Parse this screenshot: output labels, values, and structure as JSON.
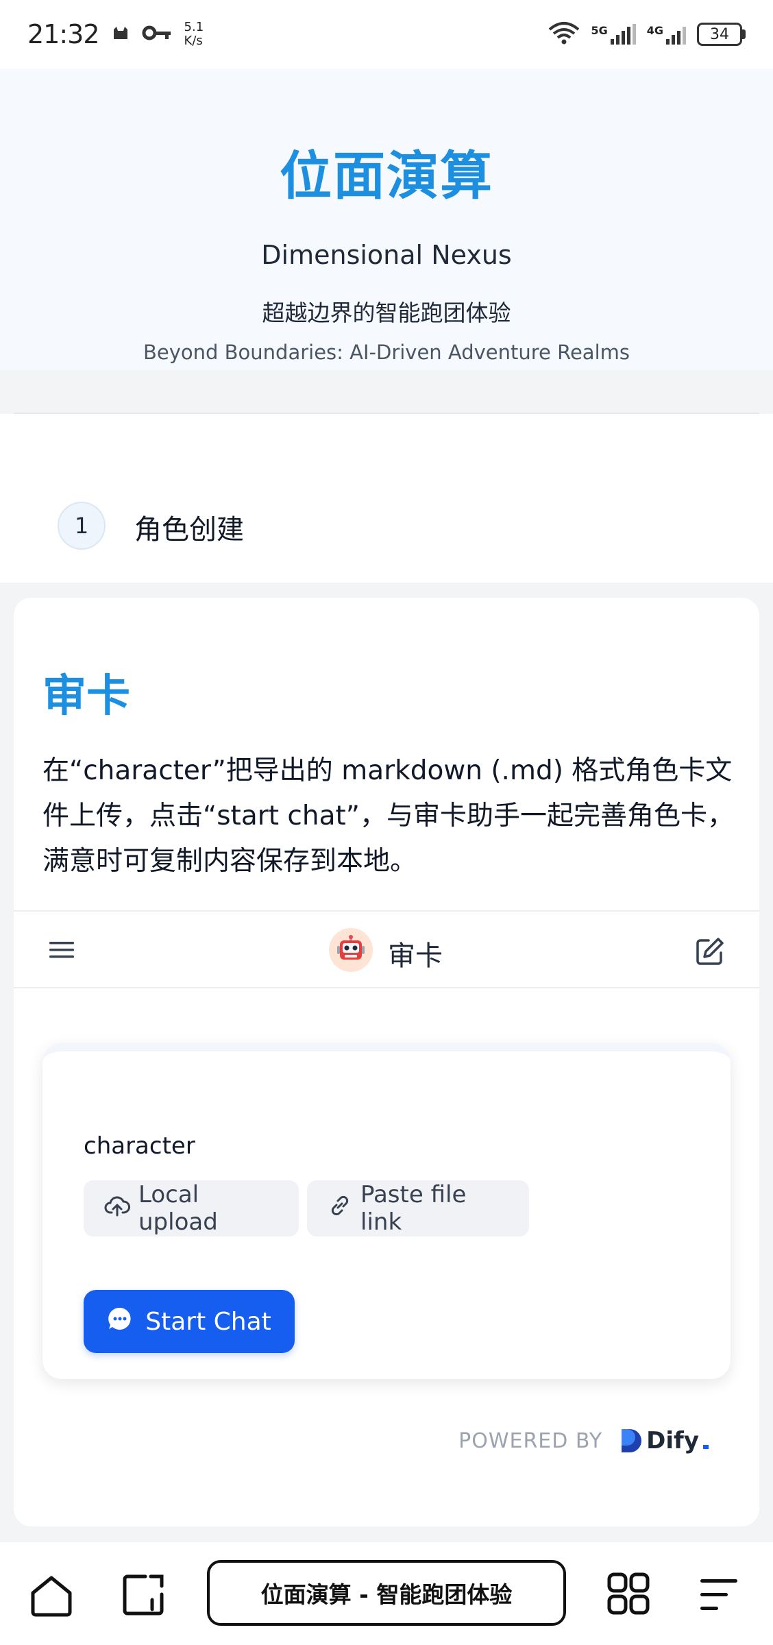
{
  "status_bar": {
    "time": "21:32",
    "speed_value": "5.1",
    "speed_unit": "K/s",
    "net1_label": "5G",
    "net2_label": "4G",
    "battery": "34"
  },
  "hero": {
    "title": "位面演算",
    "subtitle": "Dimensional Nexus",
    "tagline_cn": "超越边界的智能跑团体验",
    "tagline_en": "Beyond Boundaries: AI-Driven Adventure Realms"
  },
  "step": {
    "number": "1",
    "label": "角色创建"
  },
  "card": {
    "title": "审卡",
    "description": "在“character”把导出的 markdown (.md) 格式角色卡文件上传，点击“start chat”，与审卡助手一起完善角色卡，满意时可复制内容保存到本地。"
  },
  "chat": {
    "title": "审卡",
    "field_label": "character",
    "local_upload_label": "Local upload",
    "paste_link_label": "Paste file link",
    "start_chat_label": "Start Chat",
    "powered_by": "POWERED BY",
    "brand": "Dify"
  },
  "browser": {
    "address_text": "位面演算 - 智能跑团体验"
  },
  "colors": {
    "accent_blue": "#1d8fe0",
    "primary_button": "#155eef"
  },
  "icons": {
    "menu": "hamburger-menu-icon",
    "edit": "edit-icon",
    "upload": "cloud-upload-icon",
    "link": "link-icon",
    "chat": "chat-bubble-icon",
    "bot": "robot-icon",
    "home": "home-icon",
    "tabs": "tabs-icon",
    "apps": "apps-grid-icon",
    "nav_menu": "menu-lines-icon"
  }
}
